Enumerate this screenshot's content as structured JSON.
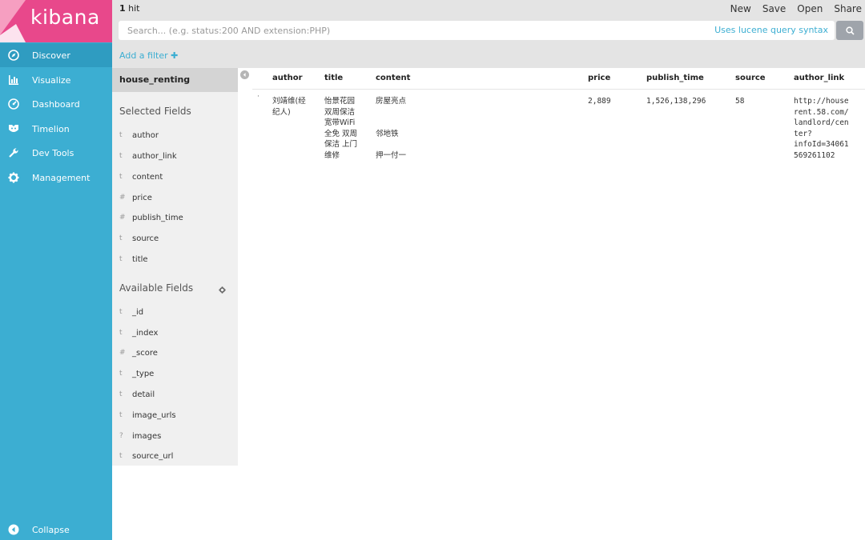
{
  "app": {
    "logo": "kibana",
    "brand_color": "#e8488b",
    "nav_color": "#3caed2"
  },
  "nav": {
    "items": [
      {
        "label": "Discover",
        "icon": "compass-icon"
      },
      {
        "label": "Visualize",
        "icon": "bar-chart-icon"
      },
      {
        "label": "Dashboard",
        "icon": "dashboard-icon"
      },
      {
        "label": "Timelion",
        "icon": "timelion-icon"
      },
      {
        "label": "Dev Tools",
        "icon": "wrench-icon"
      },
      {
        "label": "Management",
        "icon": "gear-icon"
      }
    ],
    "collapse": "Collapse"
  },
  "topbar": {
    "hits_count": "1",
    "hits_label": " hit",
    "actions": [
      "New",
      "Save",
      "Open",
      "Share"
    ],
    "search_placeholder": "Search... (e.g. status:200 AND extension:PHP)",
    "lucene_link": "Uses lucene query syntax",
    "add_filter": "Add a filter"
  },
  "sidebar": {
    "index_pattern": "house_renting",
    "selected_title": "Selected Fields",
    "selected_fields": [
      {
        "type": "t",
        "name": "author"
      },
      {
        "type": "t",
        "name": "author_link"
      },
      {
        "type": "t",
        "name": "content"
      },
      {
        "type": "#",
        "name": "price"
      },
      {
        "type": "#",
        "name": "publish_time"
      },
      {
        "type": "t",
        "name": "source"
      },
      {
        "type": "t",
        "name": "title"
      }
    ],
    "available_title": "Available Fields",
    "available_fields": [
      {
        "type": "t",
        "name": "_id"
      },
      {
        "type": "t",
        "name": "_index"
      },
      {
        "type": "#",
        "name": "_score"
      },
      {
        "type": "t",
        "name": "_type"
      },
      {
        "type": "t",
        "name": "detail"
      },
      {
        "type": "t",
        "name": "image_urls"
      },
      {
        "type": "?",
        "name": "images"
      },
      {
        "type": "t",
        "name": "source_url"
      }
    ]
  },
  "table": {
    "columns": [
      "author",
      "title",
      "content",
      "price",
      "publish_time",
      "source",
      "author_link"
    ],
    "rows": [
      {
        "author": "刘靖维(经\n纪人)",
        "title": "怡景花园\n双周保洁\n宽带WiFi\n全免 双周\n保洁 上门\n维修",
        "content": "房屋亮点\n\n\n邻地铁\n\n押一付一",
        "price": "2,889",
        "publish_time": "1,526,138,296",
        "source": "58",
        "author_link": "http://house\nrent.58.com/\nlandlord/cen\nter?\ninfoId=34061\n569261102"
      }
    ]
  }
}
